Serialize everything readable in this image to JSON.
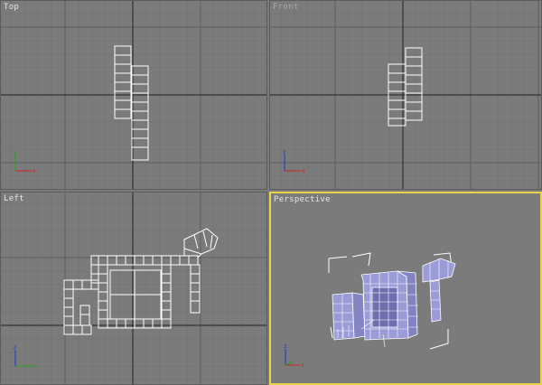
{
  "viewports": {
    "top": {
      "label": "Top",
      "axes": [
        "x",
        "y"
      ]
    },
    "front": {
      "label": "Front",
      "axes": [
        "x",
        "z"
      ]
    },
    "left": {
      "label": "Left",
      "axes": [
        "y",
        "z"
      ]
    },
    "perspective": {
      "label": "Perspective",
      "axes": [
        "x",
        "z"
      ],
      "active": true
    }
  },
  "colors": {
    "background": "#7b7b7b",
    "grid_minor": "#6e6e6e",
    "grid_major": "#5e5e5e",
    "axis_line": "#202020",
    "wireframe": "#ffffff",
    "shaded_face": "#9b9bd8",
    "active_border": "#e8d44a",
    "axis_x": "#d02020",
    "axis_y": "#20a020",
    "axis_z": "#2030d0"
  }
}
